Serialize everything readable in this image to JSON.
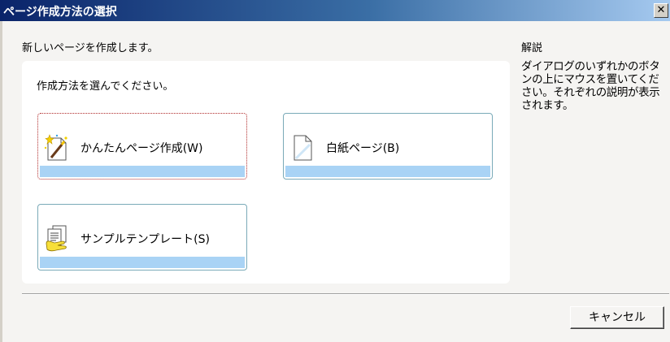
{
  "window": {
    "title": "ページ作成方法の選択",
    "close_label": "✕"
  },
  "main": {
    "subtitle": "新しいページを作成します。",
    "prompt": "作成方法を選んでください。",
    "options": [
      {
        "label": "かんたんページ作成(W)",
        "icon": "wizard-page-icon"
      },
      {
        "label": "白紙ページ(B)",
        "icon": "blank-page-icon"
      },
      {
        "label": "サンプルテンプレート(S)",
        "icon": "template-hand-icon"
      }
    ]
  },
  "side": {
    "title": "解説",
    "description": "ダイアログのいずれかのボタンの上にマウスを置いてください。それぞれの説明が表示されます。"
  },
  "footer": {
    "cancel_label": "キャンセル"
  }
}
